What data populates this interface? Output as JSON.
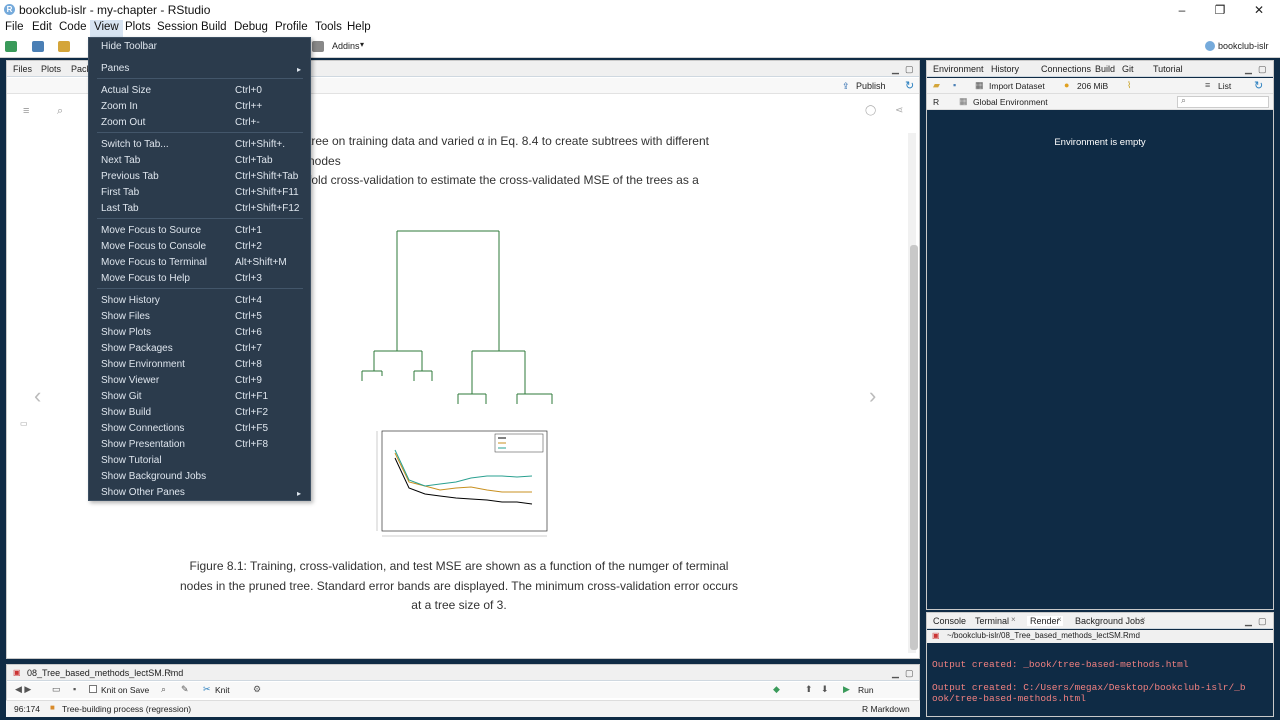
{
  "window": {
    "title": "bookclub-islr - my-chapter - RStudio"
  },
  "menubar": [
    "File",
    "Edit",
    "Code",
    "View",
    "Plots",
    "Session",
    "Build",
    "Debug",
    "Profile",
    "Tools",
    "Help"
  ],
  "toolbar": {
    "addins": "Addins",
    "project": "bookclub-islr"
  },
  "view_menu": {
    "items": [
      {
        "label": "Hide Toolbar",
        "shortcut": ""
      },
      {
        "label": "Panes",
        "shortcut": "",
        "submenu": true
      },
      {
        "label": "Actual Size",
        "shortcut": "Ctrl+0"
      },
      {
        "label": "Zoom In",
        "shortcut": "Ctrl++"
      },
      {
        "label": "Zoom Out",
        "shortcut": "Ctrl+-"
      },
      {
        "label": "Switch to Tab...",
        "shortcut": "Ctrl+Shift+."
      },
      {
        "label": "Next Tab",
        "shortcut": "Ctrl+Tab"
      },
      {
        "label": "Previous Tab",
        "shortcut": "Ctrl+Shift+Tab"
      },
      {
        "label": "First Tab",
        "shortcut": "Ctrl+Shift+F11"
      },
      {
        "label": "Last Tab",
        "shortcut": "Ctrl+Shift+F12"
      },
      {
        "label": "Move Focus to Source",
        "shortcut": "Ctrl+1"
      },
      {
        "label": "Move Focus to Console",
        "shortcut": "Ctrl+2"
      },
      {
        "label": "Move Focus to Terminal",
        "shortcut": "Alt+Shift+M"
      },
      {
        "label": "Move Focus to Help",
        "shortcut": "Ctrl+3"
      },
      {
        "label": "Show History",
        "shortcut": "Ctrl+4"
      },
      {
        "label": "Show Files",
        "shortcut": "Ctrl+5"
      },
      {
        "label": "Show Plots",
        "shortcut": "Ctrl+6"
      },
      {
        "label": "Show Packages",
        "shortcut": "Ctrl+7"
      },
      {
        "label": "Show Environment",
        "shortcut": "Ctrl+8"
      },
      {
        "label": "Show Viewer",
        "shortcut": "Ctrl+9"
      },
      {
        "label": "Show Git",
        "shortcut": "Ctrl+F1"
      },
      {
        "label": "Show Build",
        "shortcut": "Ctrl+F2"
      },
      {
        "label": "Show Connections",
        "shortcut": "Ctrl+F5"
      },
      {
        "label": "Show Presentation",
        "shortcut": "Ctrl+F8"
      },
      {
        "label": "Show Tutorial",
        "shortcut": ""
      },
      {
        "label": "Show Background Jobs",
        "shortcut": ""
      },
      {
        "label": "Show Other Panes",
        "shortcut": "",
        "submenu": true
      }
    ]
  },
  "viewer": {
    "tabs": [
      "Files",
      "Plots",
      "Pack"
    ],
    "publish": "Publish",
    "text_lines": [
      "tree on training data and varied α in Eq. 8.4 to create subtrees with different",
      "nodes",
      "fold cross-validation to estimate the cross-validated MSE of the trees as a"
    ],
    "caption": [
      "Figure 8.1: Training, cross-validation, and test MSE are shown as a function of the numger of terminal",
      "nodes in the pruned tree. Standard error bands are displayed. The minimum cross-validation error occurs",
      "at a tree size of 3."
    ]
  },
  "source": {
    "file_tab": "08_Tree_based_methods_lectSM.Rmd",
    "knit_on_save": "Knit on Save",
    "knit": "Knit",
    "run": "Run",
    "position": "96:174",
    "section": "Tree-building process (regression)",
    "mode": "R Markdown"
  },
  "env": {
    "tabs": [
      "Environment",
      "History",
      "Connections",
      "Build",
      "Git",
      "Tutorial"
    ],
    "import": "Import Dataset",
    "memory": "206 MiB",
    "list": "List",
    "lang": "R",
    "scope": "Global Environment",
    "empty": "Environment is empty"
  },
  "console": {
    "tabs": [
      "Console",
      "Terminal",
      "Render",
      "Background Jobs"
    ],
    "path": "~/bookclub-islr/08_Tree_based_methods_lectSM.Rmd",
    "lines": [
      "Output created: _book/tree-based-methods.html",
      "Output created: C:/Users/megax/Desktop/bookclub-islr/_b",
      "ook/tree-based-methods.html"
    ]
  },
  "colors": {
    "menu_bg": "#2b3b4c",
    "pane_dark": "#0f2b45",
    "accent": "#75aadb"
  }
}
